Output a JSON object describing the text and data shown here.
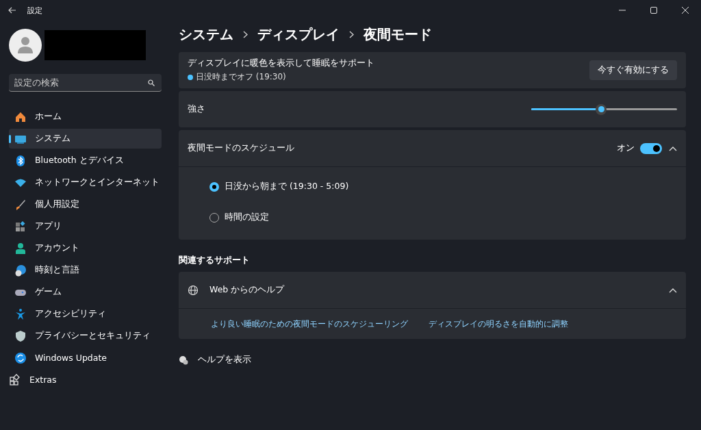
{
  "window": {
    "title": "設定"
  },
  "search": {
    "placeholder": "設定の検索"
  },
  "sidebar": {
    "items": [
      {
        "label": "ホーム",
        "selected": false
      },
      {
        "label": "システム",
        "selected": true
      },
      {
        "label": "Bluetooth とデバイス",
        "selected": false
      },
      {
        "label": "ネットワークとインターネット",
        "selected": false
      },
      {
        "label": "個人用設定",
        "selected": false
      },
      {
        "label": "アプリ",
        "selected": false
      },
      {
        "label": "アカウント",
        "selected": false
      },
      {
        "label": "時刻と言語",
        "selected": false
      },
      {
        "label": "ゲーム",
        "selected": false
      },
      {
        "label": "アクセシビリティ",
        "selected": false
      },
      {
        "label": "プライバシーとセキュリティ",
        "selected": false
      },
      {
        "label": "Windows Update",
        "selected": false
      },
      {
        "label": "Extras",
        "selected": false
      }
    ]
  },
  "breadcrumb": [
    "システム",
    "ディスプレイ",
    "夜間モード"
  ],
  "night_light": {
    "title": "ディスプレイに暖色を表示して睡眠をサポート",
    "status": "日没時までオフ (19:30)",
    "button": "今すぐ有効にする"
  },
  "strength": {
    "label": "強さ",
    "level": 0.48
  },
  "schedule": {
    "title": "夜間モードのスケジュール",
    "state_label": "オン",
    "on": true,
    "expanded": true,
    "options": [
      {
        "label": "日没から朝まで (19:30 - 5:09)",
        "selected": true
      },
      {
        "label": "時間の設定",
        "selected": false
      }
    ]
  },
  "related": {
    "heading": "関連するサポート",
    "title": "Web からのヘルプ",
    "expanded": true,
    "links": [
      "より良い睡眠のための夜間モードのスケジューリング",
      "ディスプレイの明るさを自動的に調整"
    ]
  },
  "get_help": "ヘルプを表示"
}
